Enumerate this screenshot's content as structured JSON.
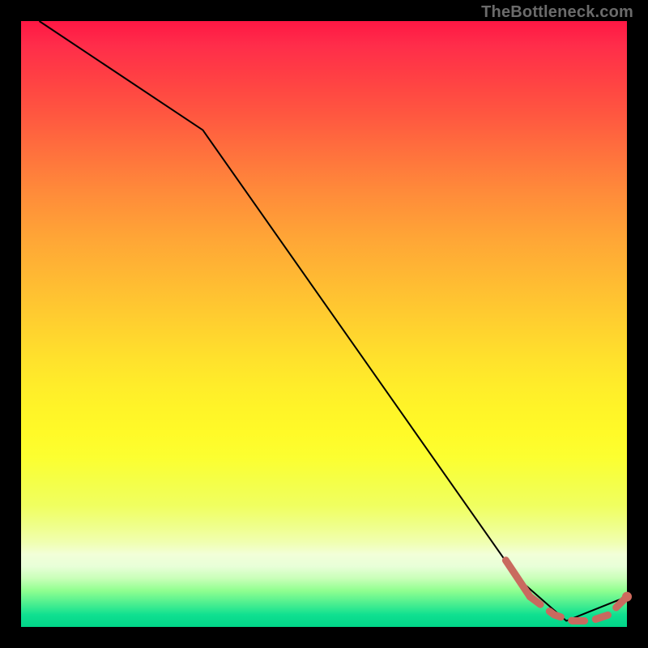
{
  "watermark": "TheBottleneck.com",
  "chart_data": {
    "type": "line",
    "title": "",
    "xlabel": "",
    "ylabel": "",
    "xlim": [
      0,
      100
    ],
    "ylim": [
      0,
      100
    ],
    "grid": false,
    "series": [
      {
        "name": "main-curve",
        "style": "solid",
        "color": "#000000",
        "x": [
          3,
          30,
          82,
          90,
          100
        ],
        "y": [
          100,
          82,
          8,
          1,
          5
        ]
      },
      {
        "name": "highlight-segment",
        "style": "dashed",
        "color": "#c96a5f",
        "x": [
          80,
          84,
          88,
          91,
          94,
          97,
          100
        ],
        "y": [
          11,
          5,
          2,
          1,
          1,
          2,
          5
        ]
      }
    ],
    "annotations": []
  }
}
